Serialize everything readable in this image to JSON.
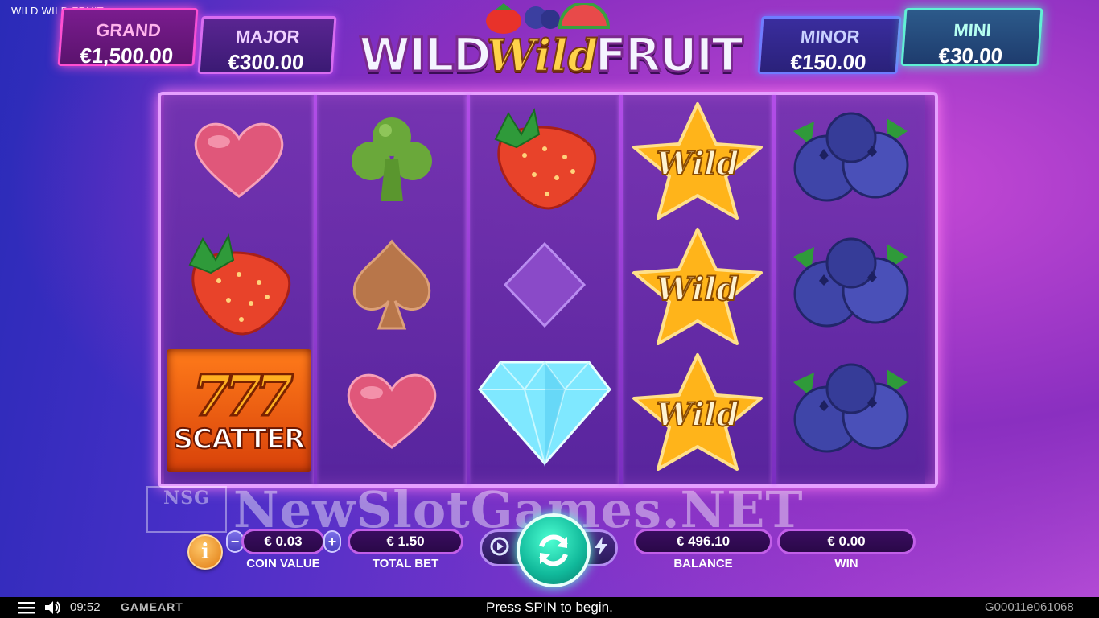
{
  "window_title": "WILD WILD FRUIT",
  "jackpots": {
    "grand": {
      "label": "GRAND",
      "value": "€1,500.00"
    },
    "major": {
      "label": "MAJOR",
      "value": "€300.00"
    },
    "minor": {
      "label": "MINOR",
      "value": "€150.00"
    },
    "mini": {
      "label": "MINI",
      "value": "€30.00"
    }
  },
  "logo": {
    "word1": "WILD",
    "word2": "Wild",
    "word3": "FRUIT"
  },
  "reels": [
    [
      "heart",
      "strawberry",
      "scatter"
    ],
    [
      "club",
      "spade",
      "heart"
    ],
    [
      "strawberry",
      "diamond-suit",
      "diamond-gem"
    ],
    [
      "wild",
      "wild",
      "wild"
    ],
    [
      "blueberry",
      "blueberry",
      "blueberry"
    ]
  ],
  "symbols": {
    "wild_label": "Wild",
    "scatter_sevens": "777",
    "scatter_label": "SCATTER"
  },
  "watermark": {
    "mark": "NSG",
    "text": "NewSlotGames.NET"
  },
  "controls": {
    "info_label": "i",
    "coin_value": "€ 0.03",
    "coin_value_label": "COIN VALUE",
    "minus": "−",
    "plus": "+",
    "total_bet": "€ 1.50",
    "total_bet_label": "TOTAL BET",
    "balance": "€ 496.10",
    "balance_label": "BALANCE",
    "win": "€ 0.00",
    "win_label": "WIN"
  },
  "status_bar": {
    "time": "09:52",
    "provider": "GAMEART",
    "message": "Press SPIN to begin.",
    "game_id": "G00011e061068"
  },
  "colors": {
    "accent": "#c25fe8",
    "spin": "#10b89a",
    "grand": "#ff4fd1",
    "mini": "#5ff2d4"
  }
}
